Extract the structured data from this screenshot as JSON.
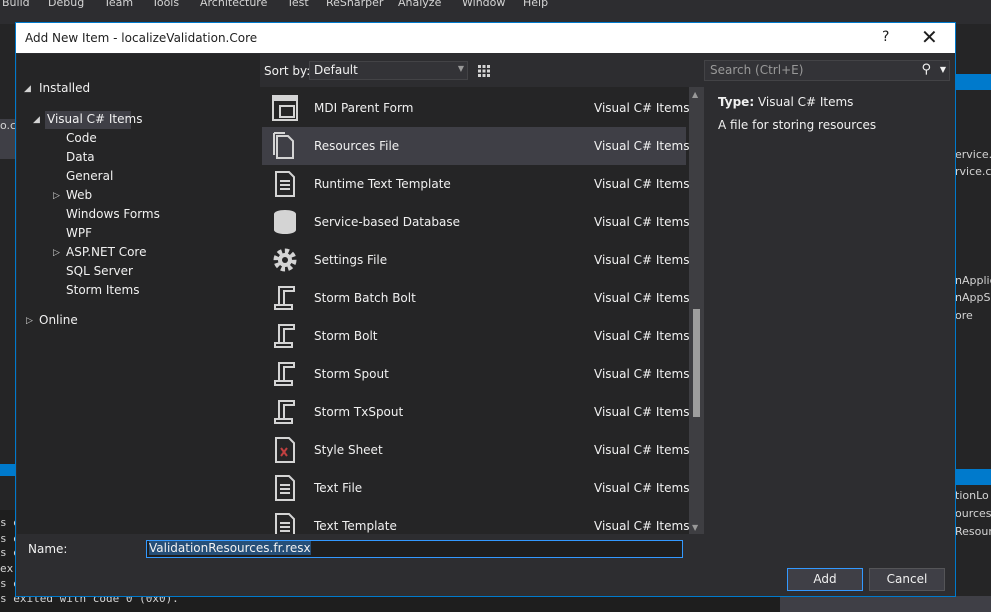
{
  "ide": {
    "menu": [
      "Build",
      "Debug",
      "Team",
      "Tools",
      "Architecture",
      "Test",
      "ReSharper",
      "Analyze",
      "Window",
      "Help"
    ],
    "left_fragment": "o.cs",
    "output_lines": [
      "s e",
      "s e",
      "s e",
      "ex",
      "s e",
      "s exited with code 0 (0x0)."
    ],
    "right_fragments": [
      "ervice.c",
      "rvice.c",
      "nApplic",
      "nAppSe",
      "ore",
      "tionLo",
      "ources",
      "Resour"
    ]
  },
  "dialog": {
    "title": "Add New Item - localizeValidation.Core",
    "help": "?",
    "close": "✕",
    "tree": {
      "installed": "Installed",
      "visual_csharp": "Visual C# Items",
      "children": [
        "Code",
        "Data",
        "General",
        "Web",
        "Windows Forms",
        "WPF",
        "ASP.NET Core",
        "SQL Server",
        "Storm Items"
      ],
      "online": "Online"
    },
    "sort_label": "Sort by:",
    "sort_value": "Default",
    "search_placeholder": "Search (Ctrl+E)",
    "items": [
      {
        "name": "MDI Parent Form",
        "category": "Visual C# Items",
        "icon": "mdi-form-icon"
      },
      {
        "name": "Resources File",
        "category": "Visual C# Items",
        "icon": "resources-file-icon"
      },
      {
        "name": "Runtime Text Template",
        "category": "Visual C# Items",
        "icon": "text-template-icon"
      },
      {
        "name": "Service-based Database",
        "category": "Visual C# Items",
        "icon": "database-icon"
      },
      {
        "name": "Settings File",
        "category": "Visual C# Items",
        "icon": "gear-icon"
      },
      {
        "name": "Storm Batch Bolt",
        "category": "Visual C# Items",
        "icon": "storm-icon"
      },
      {
        "name": "Storm Bolt",
        "category": "Visual C# Items",
        "icon": "storm-icon"
      },
      {
        "name": "Storm Spout",
        "category": "Visual C# Items",
        "icon": "storm-icon"
      },
      {
        "name": "Storm TxSpout",
        "category": "Visual C# Items",
        "icon": "storm-icon"
      },
      {
        "name": "Style Sheet",
        "category": "Visual C# Items",
        "icon": "style-sheet-icon"
      },
      {
        "name": "Text File",
        "category": "Visual C# Items",
        "icon": "text-file-icon"
      },
      {
        "name": "Text Template",
        "category": "Visual C# Items",
        "icon": "text-template-icon"
      }
    ],
    "selected_index": 1,
    "details": {
      "type_label": "Type:",
      "type_value": "Visual C# Items",
      "description": "A file for storing resources"
    },
    "name_label": "Name:",
    "name_value": "ValidationResources.fr.resx",
    "add_label": "Add",
    "cancel_label": "Cancel"
  }
}
